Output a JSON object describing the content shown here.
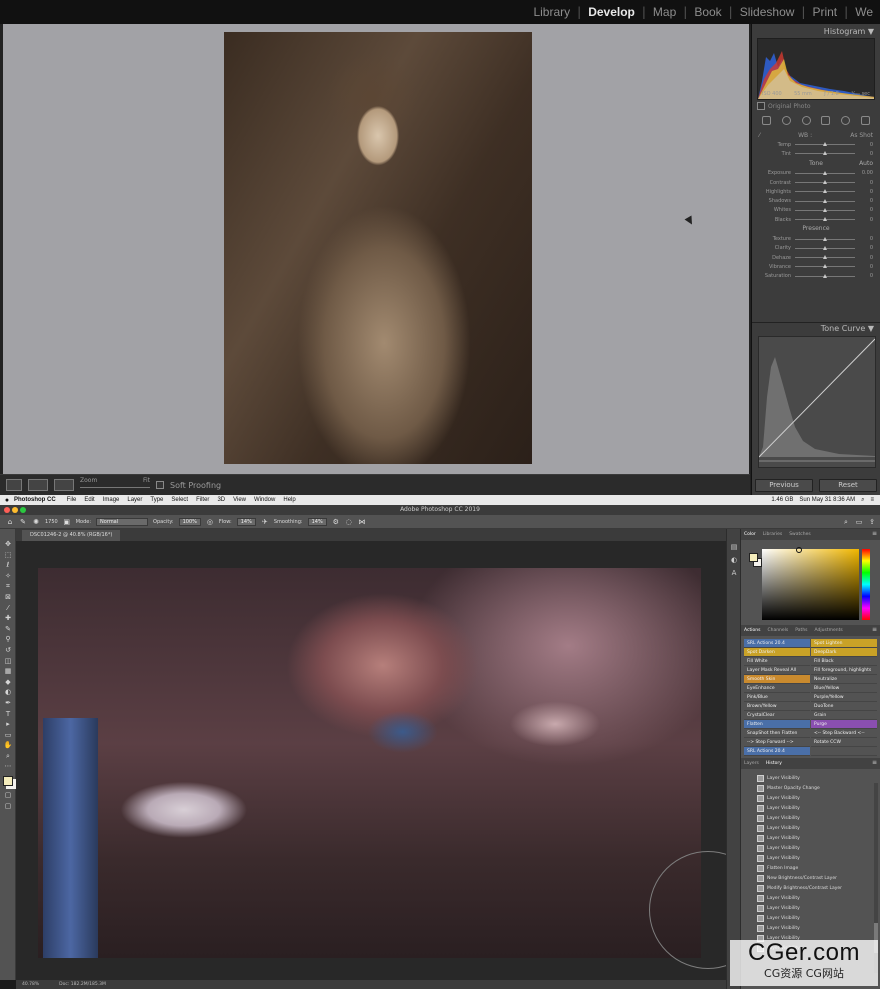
{
  "lightroom": {
    "modules": [
      "Library",
      "Develop",
      "Map",
      "Book",
      "Slideshow",
      "Print",
      "We"
    ],
    "active_module": "Develop",
    "toolbar": {
      "zoom_label": "Zoom",
      "fit_label": "Fit",
      "soft_proofing": "Soft Proofing"
    },
    "histogram": {
      "title": "Histogram",
      "iso": "ISO 400",
      "focal": "55 mm",
      "aperture": "ƒ / 1.8",
      "shutter": "¹⁄₁₀₀ sec",
      "original_photo": "Original Photo"
    },
    "basic": {
      "wb_label": "WB :",
      "wb_value": "As Shot",
      "tone_label": "Tone",
      "auto_label": "Auto",
      "presence_label": "Presence",
      "sliders": [
        {
          "name": "Temp",
          "value": "0",
          "pos": 0.5
        },
        {
          "name": "Tint",
          "value": "0",
          "pos": 0.5
        },
        {
          "name": "Exposure",
          "value": "0.00",
          "pos": 0.5
        },
        {
          "name": "Contrast",
          "value": "0",
          "pos": 0.5
        },
        {
          "name": "Highlights",
          "value": "0",
          "pos": 0.5
        },
        {
          "name": "Shadows",
          "value": "0",
          "pos": 0.5
        },
        {
          "name": "Whites",
          "value": "0",
          "pos": 0.5
        },
        {
          "name": "Blacks",
          "value": "0",
          "pos": 0.5
        },
        {
          "name": "Texture",
          "value": "0",
          "pos": 0.5
        },
        {
          "name": "Clarity",
          "value": "0",
          "pos": 0.5
        },
        {
          "name": "Dehaze",
          "value": "0",
          "pos": 0.5
        },
        {
          "name": "Vibrance",
          "value": "0",
          "pos": 0.5
        },
        {
          "name": "Saturation",
          "value": "0",
          "pos": 0.5
        }
      ]
    },
    "tone_curve": {
      "title": "Tone Curve"
    },
    "buttons": {
      "previous": "Previous",
      "reset": "Reset"
    }
  },
  "mac_menu": {
    "app": "Photoshop CC",
    "items": [
      "File",
      "Edit",
      "Image",
      "Layer",
      "Type",
      "Select",
      "Filter",
      "3D",
      "View",
      "Window",
      "Help"
    ],
    "battery": "1.46 GB",
    "clock": "Sun May 31  8:36 AM"
  },
  "photoshop": {
    "window_title": "Adobe Photoshop CC 2019",
    "options": {
      "mode_label": "Mode:",
      "mode_value": "Normal",
      "opacity_label": "Opacity:",
      "opacity_value": "100%",
      "flow_label": "Flow:",
      "flow_value": "14%",
      "smoothing_label": "Smoothing:",
      "smoothing_value": "14%",
      "brush_size": "1750"
    },
    "document_tab": "DSC01246-2 @ 40.8% (RGB/16*)",
    "status": {
      "zoom": "40.78%",
      "doc": "Doc: 182.2M/185.3M"
    },
    "color_tabs": [
      "Color",
      "Libraries",
      "Swatches"
    ],
    "action_tabs": [
      "Actions",
      "Channels",
      "Paths",
      "Adjustments"
    ],
    "actions": [
      {
        "left": "SRL Actions 20.4",
        "right": "Spot Lighten",
        "lc": "#4a6fa8",
        "rc": "#c9a227"
      },
      {
        "left": "Spot Darken",
        "right": "DeepDark",
        "lc": "#c9a227",
        "rc": "#c9a227"
      },
      {
        "left": "Fill White",
        "right": "Fill Black",
        "lc": "#535353",
        "rc": "#535353"
      },
      {
        "left": "Layer Mask Reveal All",
        "right": "Fill foreground, highlights",
        "lc": "#535353",
        "rc": "#535353"
      },
      {
        "left": "Smooth Skin",
        "right": "Neutralize",
        "lc": "#c98a2e",
        "rc": "#535353"
      },
      {
        "left": "EyeEnhance",
        "right": "Blue/Yellow",
        "lc": "#535353",
        "rc": "#535353"
      },
      {
        "left": "Pink/Blue",
        "right": "Purple/Yellow",
        "lc": "#535353",
        "rc": "#535353"
      },
      {
        "left": "Brown/Yellow",
        "right": "DuoTone",
        "lc": "#535353",
        "rc": "#535353"
      },
      {
        "left": "CrystalClear",
        "right": "Grain",
        "lc": "#535353",
        "rc": "#535353"
      },
      {
        "left": "Flatten",
        "right": "Purge",
        "lc": "#4a6fa8",
        "rc": "#8a4fb0"
      },
      {
        "left": "SnapShot then Flatten",
        "right": "<-- Step Backward <--",
        "lc": "#535353",
        "rc": "#535353"
      },
      {
        "left": "--> Step Forward -->",
        "right": "Rotate CCW",
        "lc": "#535353",
        "rc": "#535353"
      },
      {
        "left": "SRL Actions 20.4",
        "right": "",
        "lc": "#4a6fa8",
        "rc": "#535353"
      }
    ],
    "history_tabs": [
      "Layers",
      "History"
    ],
    "history": [
      "Layer Visibility",
      "Master Opacity Change",
      "Layer Visibility",
      "Layer Visibility",
      "Layer Visibility",
      "Layer Visibility",
      "Layer Visibility",
      "Layer Visibility",
      "Layer Visibility",
      "Flatten Image",
      "New Brightness/Contrast Layer",
      "Modify Brightness/Contrast Layer",
      "Layer Visibility",
      "Layer Visibility",
      "Layer Visibility",
      "Layer Visibility",
      "Layer Visibility",
      "Layer Visibility"
    ]
  },
  "watermark": {
    "main": "CGer.com",
    "sub": "CG资源 CG网站"
  }
}
